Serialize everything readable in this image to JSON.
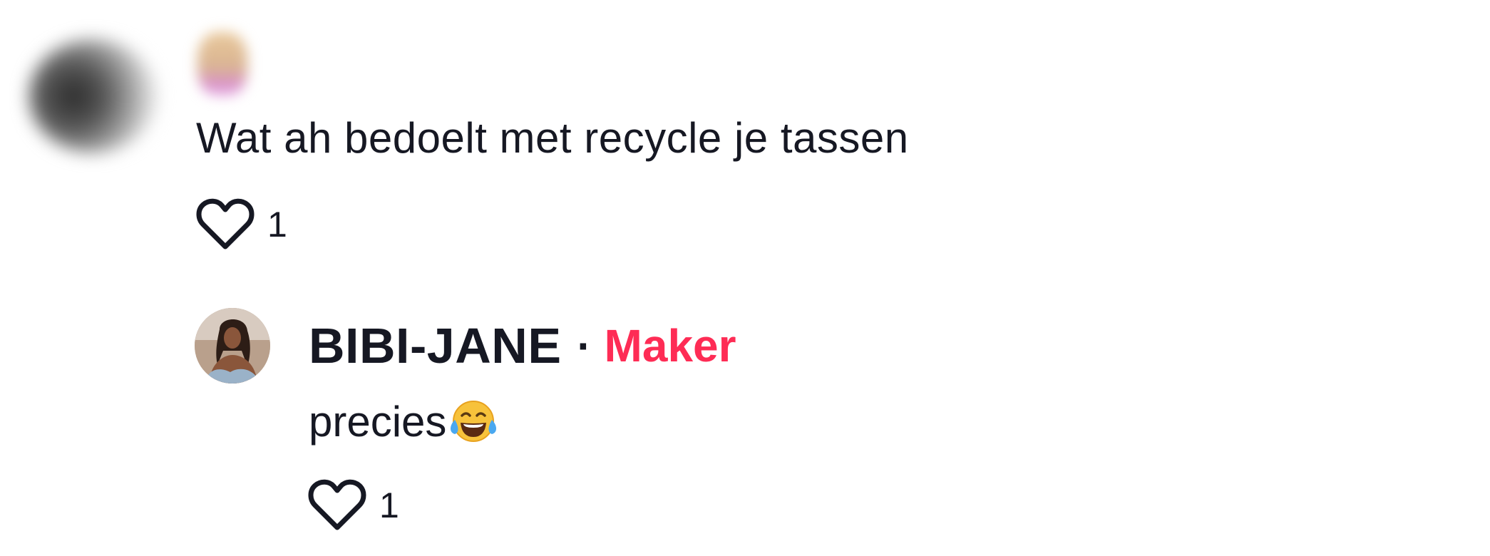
{
  "comment": {
    "text": "Wat ah bedoelt met recycle je tassen",
    "likes": "1"
  },
  "reply": {
    "username": "BIBI-JANE",
    "separator": "·",
    "badge": "Maker",
    "text": "precies",
    "emoji": "face-with-tears-of-joy-emoji",
    "likes": "1"
  },
  "colors": {
    "text": "#161823",
    "creator_badge": "#fe2c55"
  }
}
